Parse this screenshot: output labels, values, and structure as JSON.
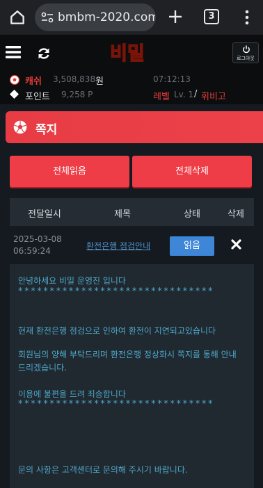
{
  "browser": {
    "url": "bmbm-2020.com",
    "tab_count": "3"
  },
  "header": {
    "logo_text": "비밀",
    "logout_label": "로그아웃"
  },
  "user": {
    "cash_label": "캐쉬",
    "cash_value": "3,508,838",
    "cash_unit": "원",
    "time": "07:12:13",
    "point_label": "포인트",
    "point_value": "9,258 P",
    "level_label": "레벨",
    "level_value": "Lv. 1",
    "level_sep": "/",
    "level_name": "휘비고"
  },
  "page": {
    "title": "쪽지"
  },
  "actions": {
    "read_all": "전체읽음",
    "delete_all": "전체삭제"
  },
  "table": {
    "headers": [
      "전달일시",
      "제목",
      "상태",
      "삭제"
    ],
    "rows": [
      {
        "date": "2025-03-08",
        "time": "06:59:24",
        "title": "환전은행 점검안내",
        "status": "읽음"
      }
    ]
  },
  "message": {
    "greeting": "안녕하세요 비밀 운영진 입니다",
    "stars": "*******************************",
    "line1": "현재 환전은행 점검으로 인하여 환전이 지연되고있습니다",
    "line2": "회원님의 양해 부탁드리며 환전은행 정상화시 쪽지를 통해 안내 드리겠습니다.",
    "line3": "이용에 불편을 드려 죄송합니다",
    "stars2": "*******************************",
    "line4": "문의 사항은 고객센터로 문의해 주시기 바랍니다."
  },
  "colors": {
    "accent_red": "#ee3d47",
    "read_blue": "#3d86d8",
    "message_text": "#4ea8c8"
  }
}
